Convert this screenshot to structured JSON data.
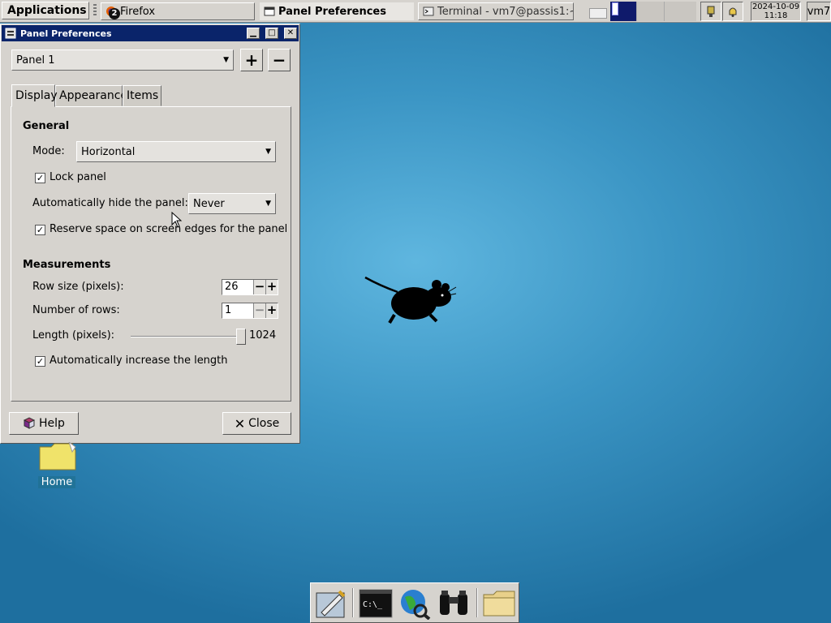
{
  "top_panel": {
    "applications_label": "Applications",
    "tasks": [
      {
        "label": "Firefox",
        "badge": "2",
        "icon": "firefox-icon",
        "active": false
      },
      {
        "label": "Panel Preferences",
        "icon": "panel-preferences-icon",
        "active": true
      },
      {
        "label": "Terminal - vm7@passis1:~",
        "icon": "terminal-icon",
        "active": false
      }
    ],
    "clock": {
      "date": "2024-10-09",
      "time": "11:18"
    },
    "user": "vm7",
    "tray_icons": [
      "network-icon",
      "notification-bell-icon"
    ]
  },
  "window": {
    "title": "Panel Preferences",
    "panel_selector": "Panel 1",
    "add_label": "+",
    "remove_label": "−",
    "tabs": [
      "Display",
      "Appearance",
      "Items"
    ],
    "active_tab": "Display",
    "general": {
      "heading": "General",
      "mode_label": "Mode:",
      "mode_value": "Horizontal",
      "lock_panel_label": "Lock panel",
      "lock_panel_checked": true,
      "autohide_label": "Automatically hide the panel:",
      "autohide_value": "Never",
      "reserve_space_label": "Reserve space on screen edges for the panel",
      "reserve_space_checked": true
    },
    "measurements": {
      "heading": "Measurements",
      "row_size_label": "Row size (pixels):",
      "row_size_value": "26",
      "rows_label": "Number of rows:",
      "rows_value": "1",
      "length_label": "Length (pixels):",
      "length_value": "1024",
      "auto_increase_label": "Automatically increase the length",
      "auto_increase_checked": true
    },
    "help_label": "Help",
    "close_label": "Close"
  },
  "desktop": {
    "home_label": "Home"
  },
  "dock": {
    "launchers": [
      "text-editor-icon",
      "terminal-icon",
      "web-browser-icon",
      "search-binoculars-icon",
      "file-manager-icon"
    ]
  }
}
